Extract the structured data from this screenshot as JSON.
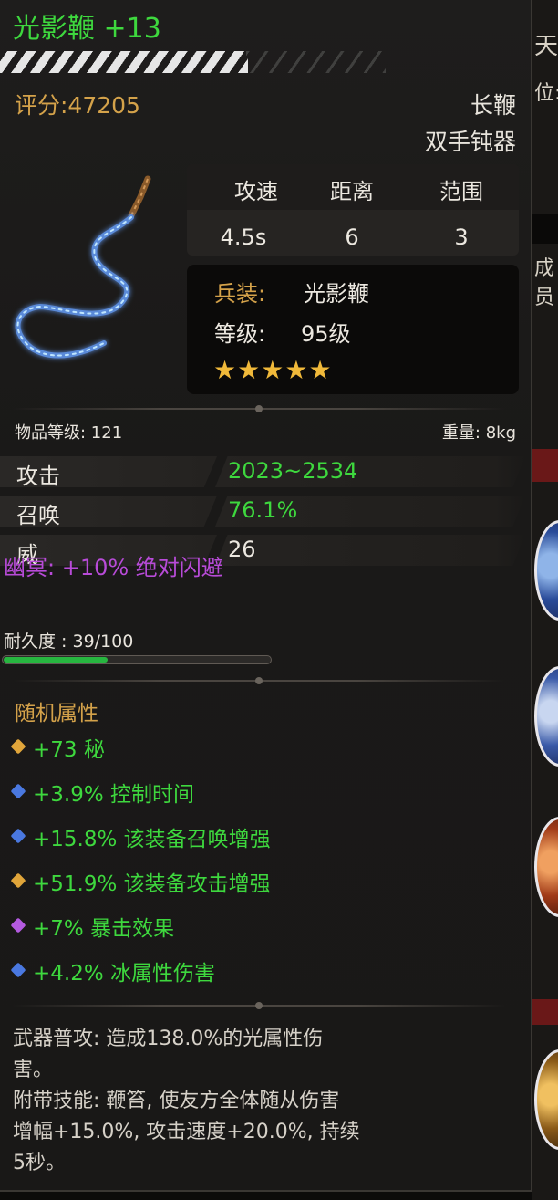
{
  "item": {
    "name": "光影鞭 +13",
    "score": "评分:47205",
    "type": "长鞭",
    "class": "双手钝器",
    "enhance_fill": 0.64
  },
  "stats": {
    "headers": [
      "攻速",
      "距离",
      "范围"
    ],
    "values": [
      "4.5s",
      "6",
      "3"
    ]
  },
  "equip": {
    "label": "兵装:",
    "value": "光影鞭",
    "level_label": "等级:",
    "level_value": "95级",
    "stars": [
      "★",
      "★",
      "★",
      "★",
      "★"
    ]
  },
  "meta": {
    "item_level": "物品等级: 121",
    "weight": "重量: 8kg"
  },
  "attributes": [
    {
      "name": "攻击",
      "value": "2023~2534",
      "color": "#3ed83e"
    },
    {
      "name": "召唤",
      "value": "76.1%",
      "color": "#3ed83e"
    },
    {
      "name": "威",
      "value": "26",
      "color": "#ece8e0"
    }
  ],
  "special": "幽冥: +10% 绝对闪避",
  "durability": {
    "label": "耐久度 : 39/100",
    "current": 39,
    "max": 100
  },
  "random": {
    "title": "随机属性",
    "items": [
      {
        "text": "+73 秘",
        "gem": "#e0a53a"
      },
      {
        "text": "+3.9% 控制时间",
        "gem": "#4a78e0"
      },
      {
        "text": "+15.8% 该装备召唤增强",
        "gem": "#4a78e0"
      },
      {
        "text": "+51.9% 该装备攻击增强",
        "gem": "#e0a53a"
      },
      {
        "text": "+7% 暴击效果",
        "gem": "#b45ae0"
      },
      {
        "text": "+4.2% 冰属性伤害",
        "gem": "#4a78e0"
      }
    ]
  },
  "description": {
    "line1": "武器普攻: 造成138.0%的光属性伤",
    "line2": "害。",
    "line3": "附带技能: 鞭笞, 使友方全体随从伤害",
    "line4": "增幅+15.0%, 攻击速度+20.0%, 持续",
    "line5": "5秒。"
  },
  "background": {
    "text1": "天",
    "text2": "位:",
    "text3": "成员"
  },
  "colors": {
    "name_green": "#3ed83e",
    "gold": "#d4a24a",
    "purple": "#b84bd8",
    "durability_green": "#27b640"
  }
}
